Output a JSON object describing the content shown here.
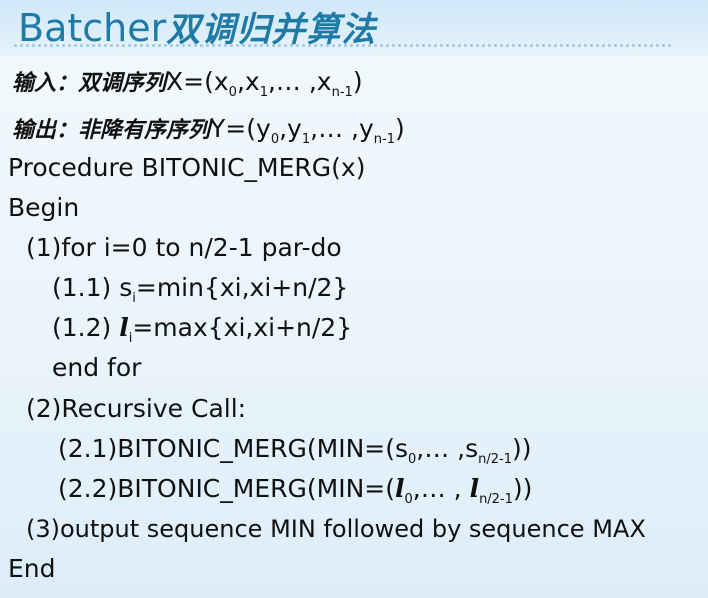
{
  "title": {
    "latin": "Batcher",
    "cjk": "双调归并算法"
  },
  "input_line": {
    "label": "输入：",
    "desc": "双调序列",
    "formula_start": "X=(x",
    "sub_0": "0",
    "sep1": ",x",
    "sub_1": "1",
    "sep2": ",… ,x",
    "sub_n1": "n-1",
    "end": ")"
  },
  "output_line": {
    "label": "输出：",
    "desc": "非降有序序列",
    "formula_start": "Y=(y",
    "sub_0": "0",
    "sep1": ",y",
    "sub_1": "1",
    "sep2": ",… ,y",
    "sub_n1": "n-1",
    "end": ")"
  },
  "code": {
    "procedure": "Procedure BITONIC_MERG(x)",
    "begin": "Begin",
    "step1": "(1)for i=0 to n/2-1 par-do",
    "step1_1_prefix": "(1.1) s",
    "step1_1_sub": "i",
    "step1_1_rest": "=min{xi,xi+n/2}",
    "step1_2_prefix": "(1.2) ",
    "step1_2_var": "l",
    "step1_2_sub": "i",
    "step1_2_rest": "=max{xi,xi+n/2}",
    "endfor": "end for",
    "step2": "(2)Recursive Call:",
    "step2_1_prefix": "(2.1)BITONIC_MERG(MIN=(s",
    "step2_1_sub0": "0",
    "step2_1_mid": ",… ,s",
    "step2_1_subn": "n/2-1",
    "step2_1_end": "))",
    "step2_2_prefix": "(2.2)BITONIC_MERG(MIN=(",
    "step2_2_var0": "l",
    "step2_2_sub0": "0",
    "step2_2_mid": ",… , ",
    "step2_2_varn": "l",
    "step2_2_subn": "n/2-1",
    "step2_2_end": "))",
    "step3": "(3)output sequence MIN followed by sequence MAX",
    "end": "End"
  },
  "colors": {
    "title": "#1f7aa6",
    "background": "#eaf4fb",
    "text": "#111111"
  }
}
